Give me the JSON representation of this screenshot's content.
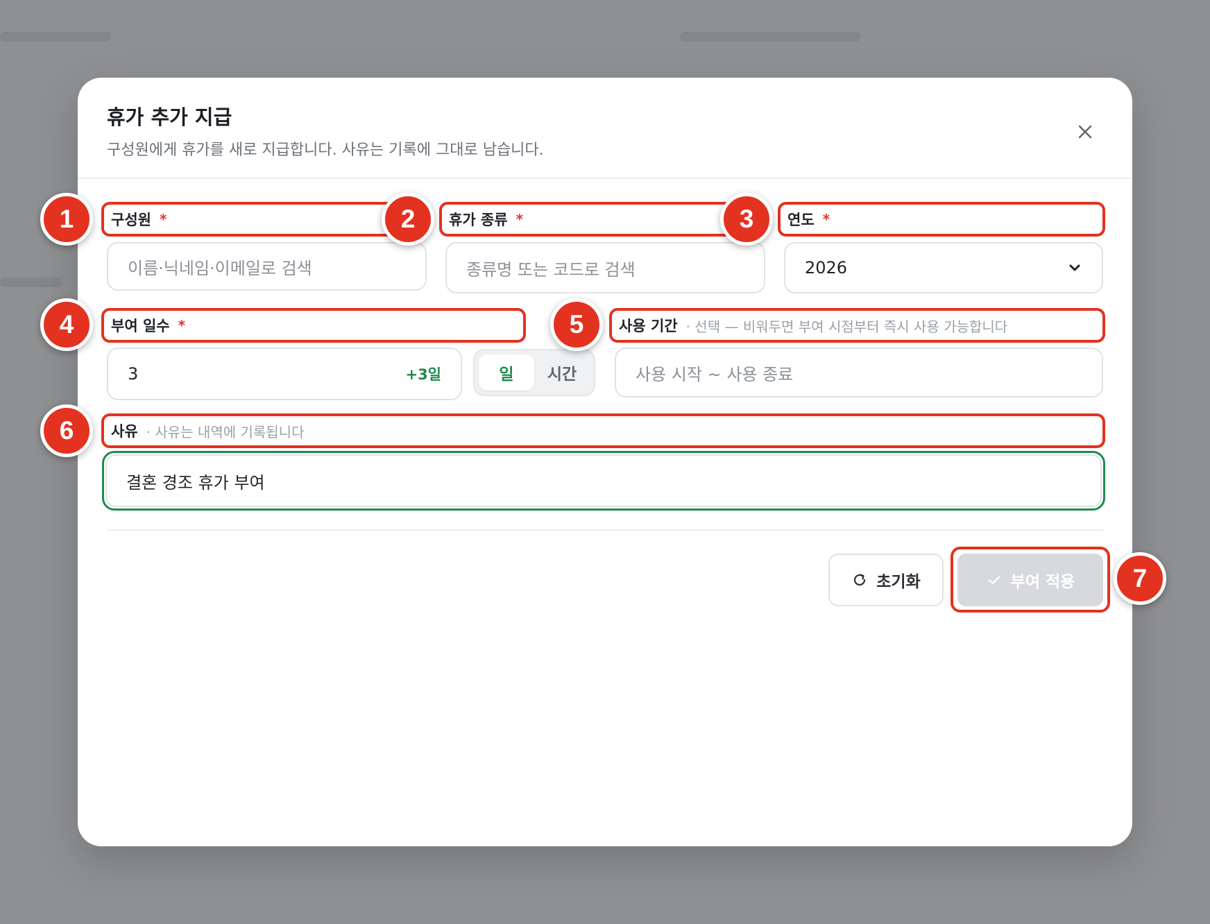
{
  "modal": {
    "title": "휴가 추가 지급",
    "subtitle": "구성원에게 휴가를 새로 지급합니다. 사유는 기록에 그대로 남습니다."
  },
  "fields": {
    "member": {
      "label": "구성원",
      "required_mark": "*",
      "placeholder": "이름·닉네임·이메일로 검색"
    },
    "leave_type": {
      "label": "휴가 종류",
      "required_mark": "*",
      "placeholder": "종류명 또는 코드로 검색"
    },
    "year": {
      "label": "연도",
      "required_mark": "*",
      "value": "2026"
    },
    "days": {
      "label": "부여 일수",
      "required_mark": "*",
      "value": "3",
      "suffix": "+3일",
      "unit_options": [
        "일",
        "시간"
      ],
      "selected_unit": "일"
    },
    "period": {
      "label": "사용 기간",
      "hint": "· 선택 — 비워두면 부여 시점부터 즉시 사용 가능합니다",
      "placeholder": "사용 시작 ~ 사용 종료"
    },
    "reason": {
      "label": "사유",
      "hint": "· 사유는 내역에 기록됩니다",
      "value": "결혼 경조 휴가 부여"
    }
  },
  "actions": {
    "reset_label": "초기화",
    "apply_label": "부여 적용"
  },
  "annotations": [
    "1",
    "2",
    "3",
    "4",
    "5",
    "6",
    "7"
  ],
  "colors": {
    "accent_green": "#1e8a4c",
    "highlight_red": "#e3321f",
    "disabled_button": "#d7d9dc"
  },
  "icons": [
    "close-icon",
    "chevron-down-icon",
    "refresh-icon",
    "check-icon"
  ]
}
